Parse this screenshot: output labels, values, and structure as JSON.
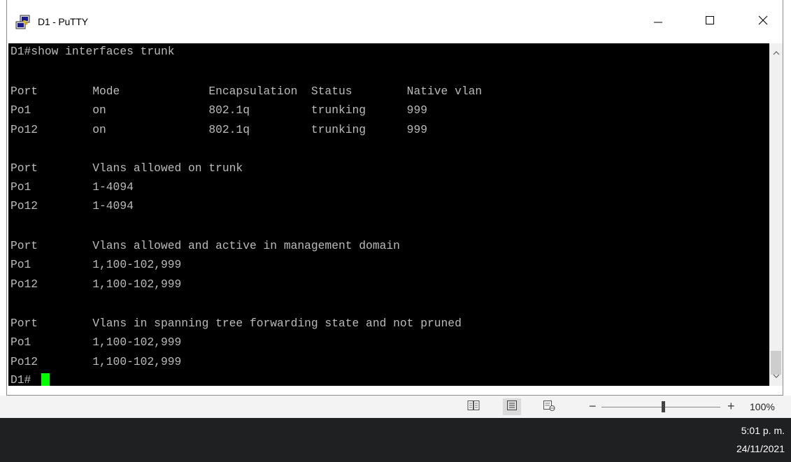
{
  "window": {
    "title": "D1 - PuTTY"
  },
  "terminal": {
    "lines": [
      "D1#show interfaces trunk",
      "",
      "Port        Mode             Encapsulation  Status        Native vlan",
      "Po1         on               802.1q         trunking      999",
      "Po12        on               802.1q         trunking      999",
      "",
      "Port        Vlans allowed on trunk",
      "Po1         1-4094",
      "Po12        1-4094",
      "",
      "Port        Vlans allowed and active in management domain",
      "Po1         1,100-102,999",
      "Po12        1,100-102,999",
      "",
      "Port        Vlans in spanning tree forwarding state and not pruned",
      "Po1         1,100-102,999",
      "Po12        1,100-102,999",
      "D1#"
    ],
    "cursor_color": "#00ff00"
  },
  "statusbar": {
    "zoom_minus": "−",
    "zoom_plus": "+",
    "zoom_level": "100%"
  },
  "taskbar": {
    "time": "5:01 p. m.",
    "date": "24/11/2021"
  },
  "colors": {
    "terminal_bg": "#000000",
    "terminal_fg": "#bbbbbb",
    "taskbar_bg": "#1f2022"
  }
}
